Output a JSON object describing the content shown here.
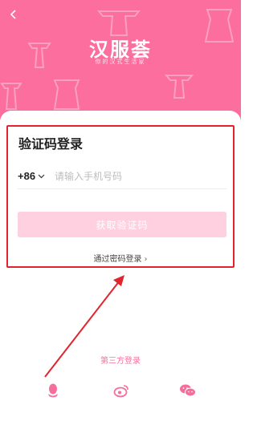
{
  "app": {
    "logo_text": "汉服荟",
    "tagline": "你的汉式生活家"
  },
  "login": {
    "title": "验证码登录",
    "country_code": "+86",
    "phone_placeholder": "请输入手机号码",
    "get_code_label": "获取验证码",
    "password_login_label": "通过密码登录"
  },
  "third_party": {
    "title": "第三方登录",
    "providers": [
      {
        "name": "qq",
        "icon": "qq-icon"
      },
      {
        "name": "weibo",
        "icon": "weibo-icon"
      },
      {
        "name": "wechat",
        "icon": "wechat-icon"
      }
    ]
  },
  "colors": {
    "brand_pink": "#fb6e9d",
    "button_disabled_pink": "#ffd0df",
    "annotation_red": "#e0252d"
  }
}
